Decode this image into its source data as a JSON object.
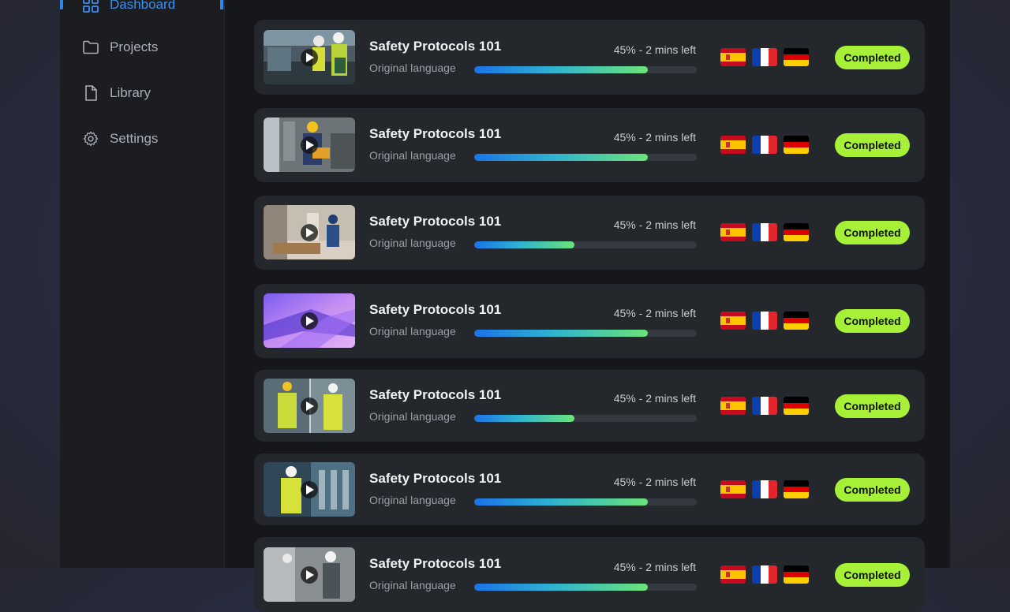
{
  "sidebar": {
    "items": [
      {
        "label": "Dashboard",
        "icon": "dashboard-icon",
        "active": true
      },
      {
        "label": "Projects",
        "icon": "folder-icon"
      },
      {
        "label": "Library",
        "icon": "file-icon"
      },
      {
        "label": "Settings",
        "icon": "gear-icon"
      }
    ]
  },
  "colors": {
    "accent": "#2f87ea",
    "badge": "#a6f037",
    "card": "#24272c"
  },
  "videos": [
    {
      "title": "Safety Protocols 101",
      "subtitle": "Original language",
      "progress_text": "45% - 2 mins left",
      "progress": 0.78,
      "status": "Completed",
      "thumb": "warehouse-workers"
    },
    {
      "title": "Safety Protocols 101",
      "subtitle": "Original language",
      "progress_text": "45% - 2 mins left",
      "progress": 0.78,
      "status": "Completed",
      "thumb": "factory-worker"
    },
    {
      "title": "Safety Protocols 101",
      "subtitle": "Original language",
      "progress_text": "45% - 2 mins left",
      "progress": 0.45,
      "status": "Completed",
      "thumb": "workshop-worker"
    },
    {
      "title": "Safety Protocols 101",
      "subtitle": "Original language",
      "progress_text": "45% - 2 mins left",
      "progress": 0.78,
      "status": "Completed",
      "thumb": "abstract-purple"
    },
    {
      "title": "Safety Protocols 101",
      "subtitle": "Original language",
      "progress_text": "45% - 2 mins left",
      "progress": 0.45,
      "status": "Completed",
      "thumb": "two-workers-vests"
    },
    {
      "title": "Safety Protocols 101",
      "subtitle": "Original language",
      "progress_text": "45% - 2 mins left",
      "progress": 0.78,
      "status": "Completed",
      "thumb": "worker-machinery"
    },
    {
      "title": "Safety Protocols 101",
      "subtitle": "Original language",
      "progress_text": "45% - 2 mins left",
      "progress": 0.78,
      "status": "Completed",
      "thumb": "workers-partial"
    }
  ],
  "languages": [
    "spanish-flag",
    "french-flag",
    "german-flag"
  ]
}
